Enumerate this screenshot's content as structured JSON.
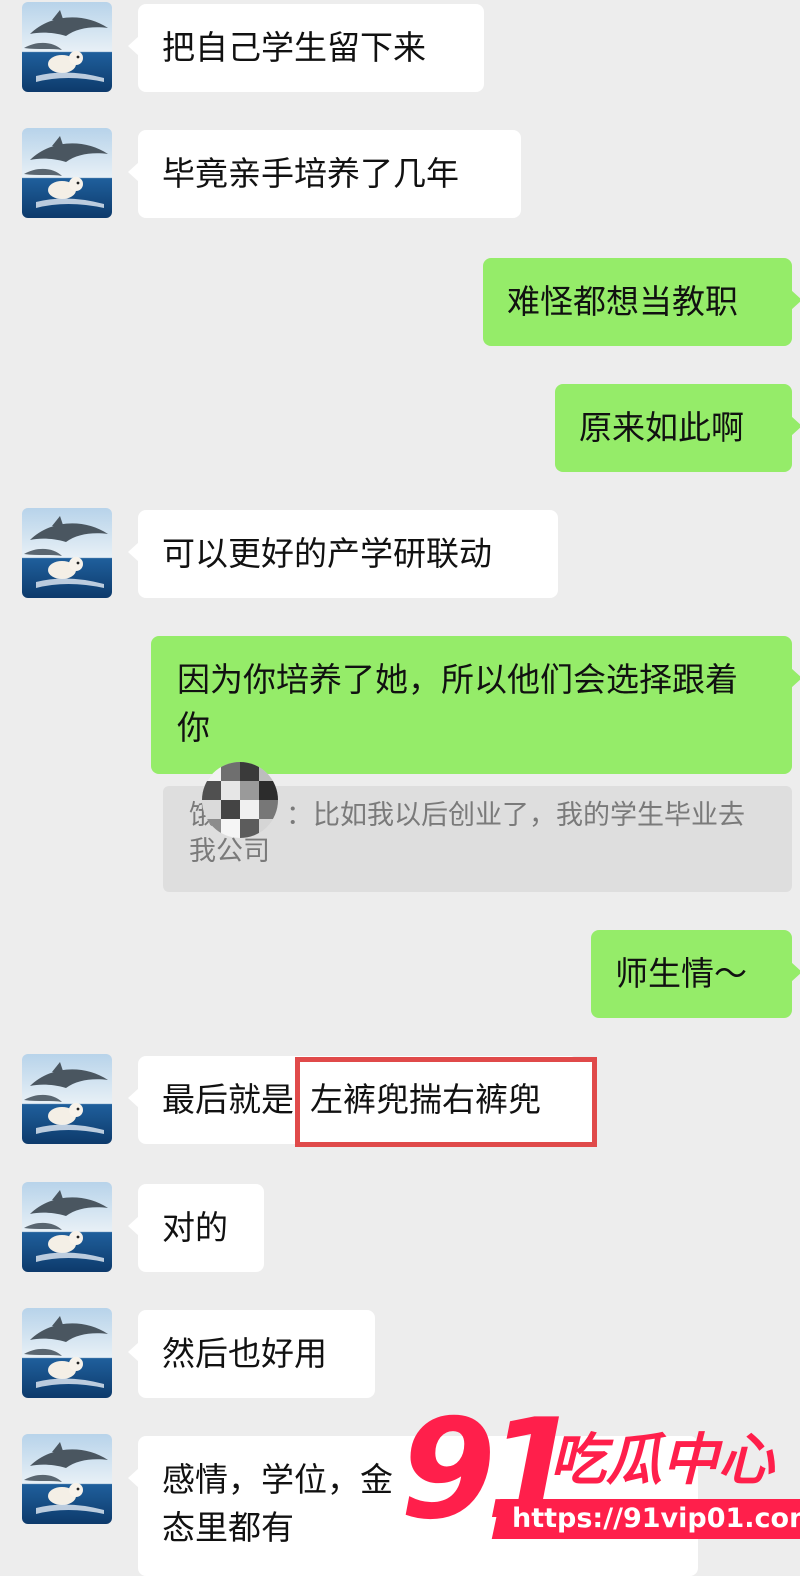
{
  "messages": [
    {
      "side": "in",
      "text": "把自己学生留下来"
    },
    {
      "side": "in",
      "text": "毕竟亲手培养了几年"
    },
    {
      "side": "out",
      "text": "难怪都想当教职"
    },
    {
      "side": "out",
      "text": "原来如此啊"
    },
    {
      "side": "in",
      "text": "可以更好的产学研联动"
    },
    {
      "side": "out",
      "text": "因为你培养了她，所以他们会选择跟着你"
    },
    {
      "side": "out",
      "text": "师生情～"
    },
    {
      "side": "in",
      "text_before": "最后就是",
      "text_highlight": "左裤兜揣右裤兜"
    },
    {
      "side": "in",
      "text": "对的"
    },
    {
      "side": "in",
      "text": "然后也好用"
    },
    {
      "side": "in",
      "text": "感情，学位，金",
      "text_line2": "态里都有"
    }
  ],
  "quote": {
    "sender_visible": "饿",
    "sender_suffix": "：",
    "text": "比如我以后创业了，我的学生毕业去我公司"
  },
  "watermark": {
    "number": "91",
    "title": "吃瓜中心",
    "url": "https://91vip01.com"
  },
  "colors": {
    "background": "#ededed",
    "incoming_bubble": "#ffffff",
    "outgoing_bubble": "#95ec69",
    "highlight_border": "#e04a4a",
    "watermark": "#ff1f4b"
  }
}
